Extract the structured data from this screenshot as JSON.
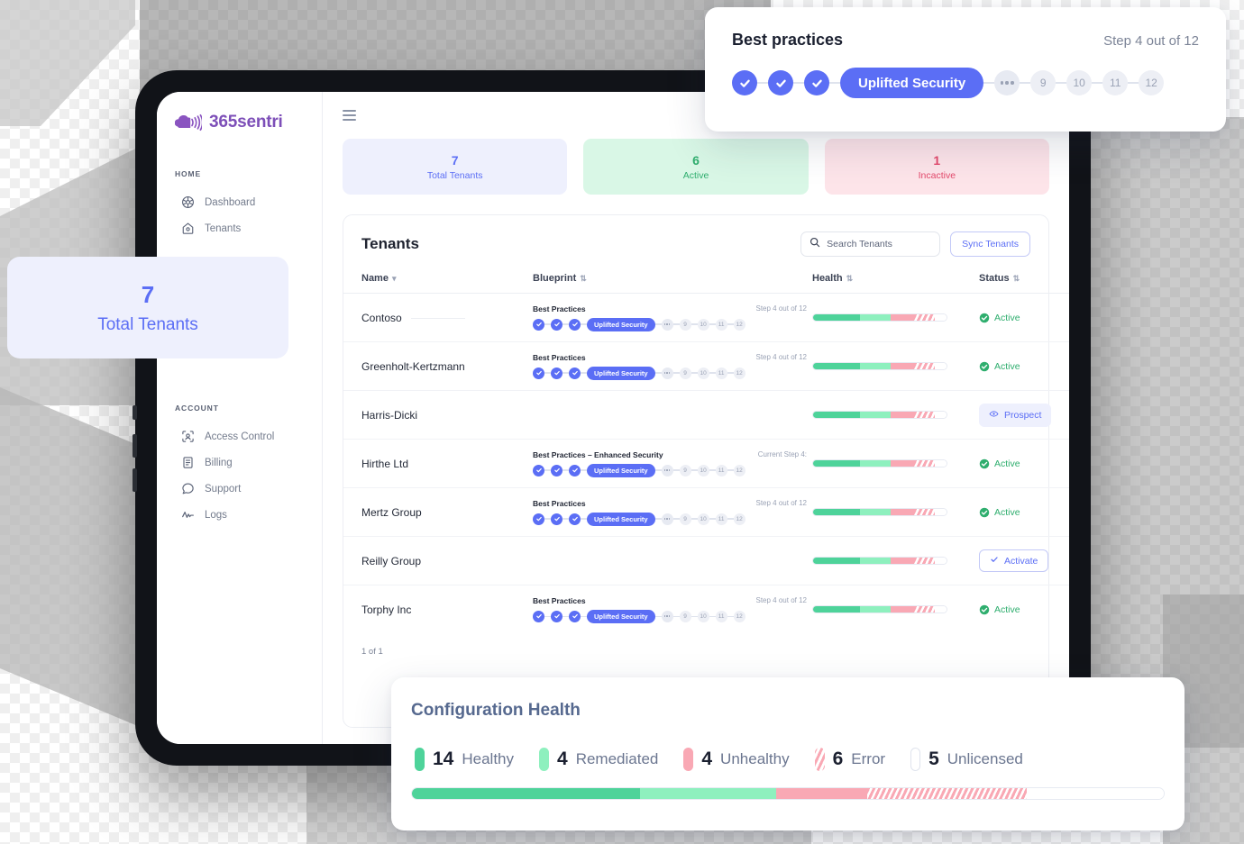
{
  "brand": {
    "name": "365sentri",
    "logo_icon": "cloud-signal-icon",
    "color": "#7d4fb8"
  },
  "sidebar": {
    "sections": [
      {
        "label": "HOME",
        "items": [
          {
            "label": "Dashboard",
            "icon": "dashboard-icon"
          },
          {
            "label": "Tenants",
            "icon": "home-tenants-icon"
          }
        ]
      },
      {
        "label": "ACCOUNT",
        "items": [
          {
            "label": "Access Control",
            "icon": "access-control-icon"
          },
          {
            "label": "Billing",
            "icon": "billing-icon"
          },
          {
            "label": "Support",
            "icon": "support-chat-icon"
          },
          {
            "label": "Logs",
            "icon": "logs-activity-icon"
          }
        ]
      }
    ]
  },
  "topbar": {
    "menu_icon": "hamburger-icon"
  },
  "stats": [
    {
      "value": "7",
      "label": "Total Tenants",
      "color": "#5b6ef5"
    },
    {
      "value": "6",
      "label": "Active",
      "color": "#2fae6e"
    },
    {
      "value": "1",
      "label": "Incactive",
      "color": "#e3486b"
    }
  ],
  "panel": {
    "title": "Tenants",
    "search": {
      "placeholder": "Search Tenants",
      "value": "",
      "icon": "search-icon"
    },
    "sync_label": "Sync Tenants",
    "columns": [
      {
        "label": "Name",
        "sorter": "▾"
      },
      {
        "label": "Blueprint",
        "sorter": "⇅"
      },
      {
        "label": "Health",
        "sorter": "⇅"
      },
      {
        "label": "Status",
        "sorter": "⇅"
      }
    ],
    "pagination": "1 of 1",
    "stepper_numbers": [
      "9",
      "10",
      "11",
      "12"
    ],
    "stepper_pill_label": "Uplifted Security",
    "rows": [
      {
        "name": "Contoso",
        "blueprint": "Best Practices",
        "step": "Step 4 out of 12",
        "has_blueprint": true,
        "status": "Active",
        "status_type": "active"
      },
      {
        "name": "Greenholt-Kertzmann",
        "blueprint": "Best Practices",
        "step": "Step 4 out of 12",
        "has_blueprint": true,
        "status": "Active",
        "status_type": "active"
      },
      {
        "name": "Harris-Dicki",
        "blueprint": "",
        "step": "",
        "has_blueprint": false,
        "status": "Prospect",
        "status_type": "prospect"
      },
      {
        "name": "Hirthe Ltd",
        "blueprint": "Best Practices – Enhanced Security",
        "step": "Current Step 4:",
        "has_blueprint": true,
        "status": "Active",
        "status_type": "active"
      },
      {
        "name": "Mertz Group",
        "blueprint": "Best Practices",
        "step": "Step 4 out of 12",
        "has_blueprint": true,
        "status": "Active",
        "status_type": "active"
      },
      {
        "name": "Reilly Group",
        "blueprint": "",
        "step": "",
        "has_blueprint": false,
        "status": "Activate",
        "status_type": "activate"
      },
      {
        "name": "Torphy Inc",
        "blueprint": "Best Practices",
        "step": "Step 4 out of 12",
        "has_blueprint": true,
        "status": "Active",
        "status_type": "active"
      }
    ],
    "row_health": {
      "healthy": 35,
      "remediated": 23,
      "unhealthy": 18,
      "error": 15,
      "unlicensed": 9
    }
  },
  "bp_card": {
    "title": "Best practices",
    "step_text": "Step 4 out of 12",
    "pill_label": "Uplifted Security",
    "numbers": [
      "9",
      "10",
      "11",
      "12"
    ]
  },
  "tt_card": {
    "value": "7",
    "label": "Total Tenants"
  },
  "config_health": {
    "title": "Configuration Health",
    "legend": [
      {
        "count": "14",
        "label": "Healthy",
        "swatch": "sw-healthy",
        "color": "#4ed39a"
      },
      {
        "count": "4",
        "label": "Remediated",
        "swatch": "sw-remediated",
        "color": "#8ef0be"
      },
      {
        "count": "4",
        "label": "Unhealthy",
        "swatch": "sw-unhealthy",
        "color": "#f9a8b4"
      },
      {
        "count": "6",
        "label": "Error",
        "swatch": "sw-error",
        "color": "#f9a8b4"
      },
      {
        "count": "5",
        "label": "Unlicensed",
        "swatch": "sw-unlic",
        "color": "#ffffff"
      }
    ],
    "bar": {
      "healthy": 30.3,
      "remediated": 18.2,
      "unhealthy": 12.1,
      "error": 21.2,
      "unlicensed": 18.2
    }
  }
}
